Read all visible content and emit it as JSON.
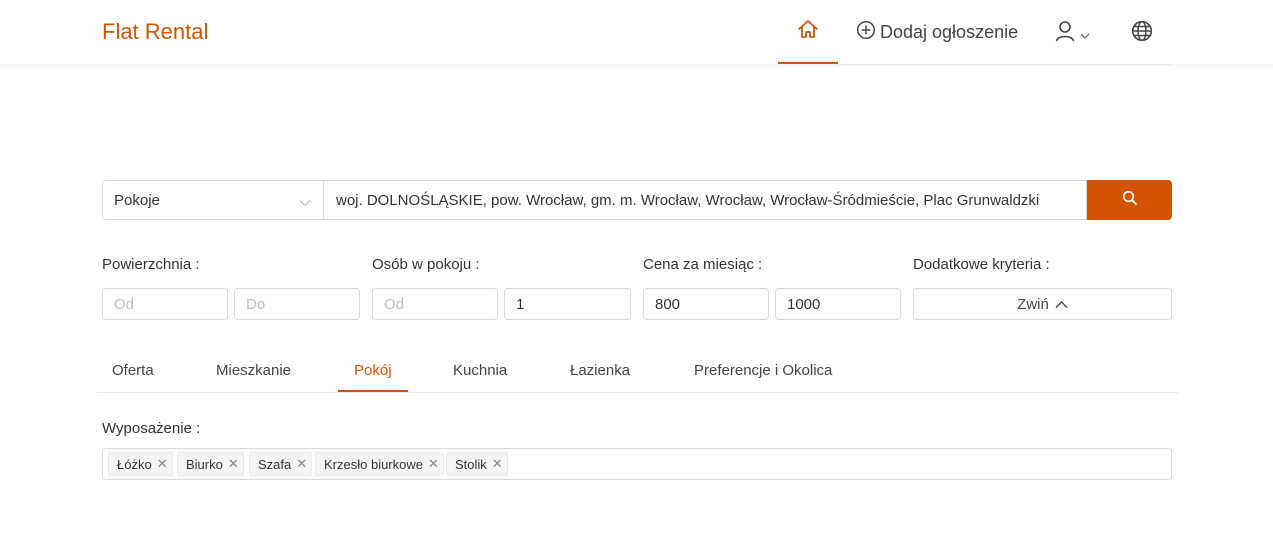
{
  "header": {
    "logo": "Flat Rental",
    "add_listing": "Dodaj ogłoszenie"
  },
  "search": {
    "type_value": "Pokoje",
    "location_value": "woj. DOLNOŚLĄSKIE, pow. Wrocław, gm. m. Wrocław, Wrocław, Wrocław-Śródmieście, Plac Grunwaldzki"
  },
  "filters": {
    "area_label": "Powierzchnia",
    "area_from_placeholder": "Od",
    "area_to_placeholder": "Do",
    "persons_label": "Osób w pokoju",
    "persons_from_placeholder": "Od",
    "persons_to_value": "1",
    "price_label": "Cena za miesiąc",
    "price_from_value": "800",
    "price_to_value": "1000",
    "extra_label": "Dodatkowe kryteria",
    "collapse_label": "Zwiń"
  },
  "tabs": [
    "Oferta",
    "Mieszkanie",
    "Pokój",
    "Kuchnia",
    "Łazienka",
    "Preferencje i Okolica"
  ],
  "active_tab": "Pokój",
  "equipment": {
    "label": "Wyposażenie",
    "tags": [
      "Łóżko",
      "Biurko",
      "Szafa",
      "Krzesło biurkowe",
      "Stolik"
    ]
  },
  "colors": {
    "accent": "#d35400"
  }
}
